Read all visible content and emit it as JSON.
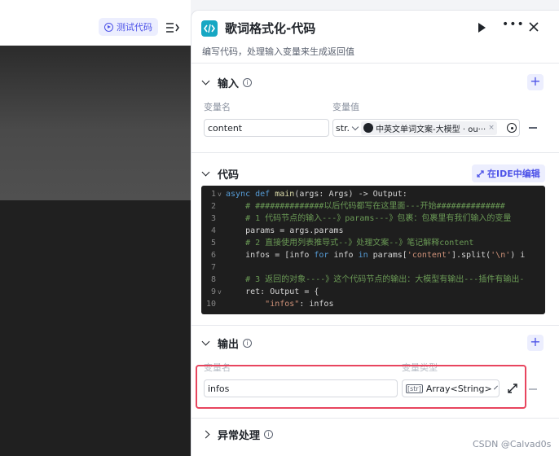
{
  "canvas": {
    "test_button_label": "测试代码"
  },
  "panel": {
    "title": "歌词格式化-代码",
    "description": "编写代码，处理输入变量来生成返回值"
  },
  "input_section": {
    "title": "输入",
    "col_name": "变量名",
    "col_value": "变量值",
    "row": {
      "name": "content",
      "type_short": "str.",
      "ref_value": "中英文单词文案-大模型 · ou···"
    }
  },
  "code_section": {
    "title": "代码",
    "ide_button_label": "在IDE中编辑",
    "lines": [
      {
        "n": "1",
        "fold": "v"
      },
      {
        "n": "2",
        "fold": ""
      },
      {
        "n": "3",
        "fold": ""
      },
      {
        "n": "4",
        "fold": ""
      },
      {
        "n": "5",
        "fold": ""
      },
      {
        "n": "6",
        "fold": ""
      },
      {
        "n": "7",
        "fold": ""
      },
      {
        "n": "8",
        "fold": ""
      },
      {
        "n": "9",
        "fold": "v"
      },
      {
        "n": "10",
        "fold": ""
      }
    ],
    "tokens": {
      "l1_async": "async def",
      "l1_main": "main",
      "l1_rest": "(args: Args) -> Output:",
      "l2_comment": "# ##############以后代码都写在这里面---开始##############",
      "l3_comment": "# 1 代码节点的输入---》params---》包裹：包裹里有我们输入的变量",
      "l4_code": "params = args.params",
      "l5_comment": "# 2 直接使用列表推导式--》处理文案--》笔记解释content",
      "l6_a": "infos = [info ",
      "l6_for": "for",
      "l6_b": " info ",
      "l6_in": "in",
      "l6_c": " params[",
      "l6_str": "'content'",
      "l6_d": "].split(",
      "l6_str2": "'\\n'",
      "l6_e": ") i",
      "l8_comment": "# 3 返回的对象----》这个代码节点的输出：大模型有输出---插件有输出-",
      "l9_code": "ret: Output = {",
      "l10_str": "\"infos\"",
      "l10_rest": ": infos"
    }
  },
  "output_section": {
    "title": "输出",
    "col_name": "变量名",
    "col_type": "变量类型",
    "row": {
      "name": "infos",
      "type": "Array<String>",
      "type_icon_text": "[str]"
    }
  },
  "exception_section": {
    "title": "异常处理"
  },
  "watermark": "CSDN @Calvad0s",
  "colors": {
    "accent": "#4d53e8",
    "node_icon": "#16a7c3",
    "highlight": "#e8455e",
    "code_bg": "#1e1e1e"
  }
}
